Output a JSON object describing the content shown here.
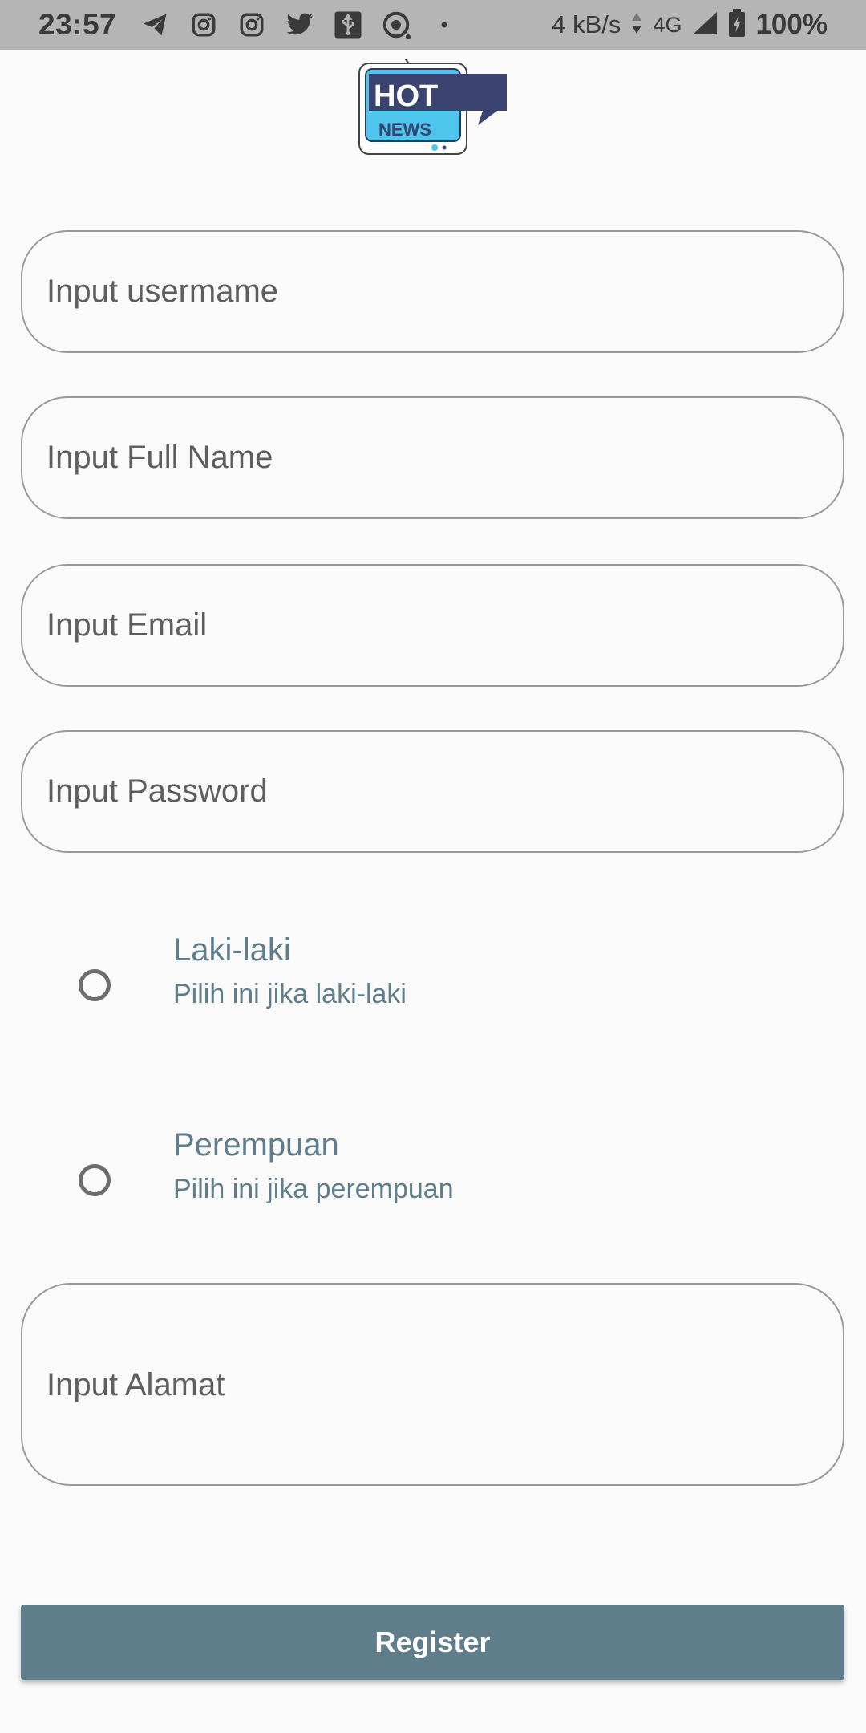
{
  "status_bar": {
    "time": "23:57",
    "net_speed": "4 kB/s",
    "network_type": "4G",
    "battery_percent": "100%",
    "left_icons": [
      "telegram-icon",
      "instagram-icon",
      "instagram-icon",
      "twitter-icon",
      "usb-icon",
      "vpn-icon"
    ],
    "bg_color": "#b5b5b5"
  },
  "logo": {
    "line1": "HOT",
    "line2": "NEWS"
  },
  "form": {
    "username_placeholder": "Input usermame",
    "fullname_placeholder": "Input Full Name",
    "email_placeholder": "Input Email",
    "password_placeholder": "Input Password",
    "address_placeholder": "Input Alamat",
    "gender_options": [
      {
        "title": "Laki-laki",
        "subtitle": "Pilih ini jika laki-laki",
        "selected": false
      },
      {
        "title": "Perempuan",
        "subtitle": "Pilih ini jika perempuan",
        "selected": false
      }
    ],
    "register_label": "Register"
  },
  "colors": {
    "accent": "#607d8b",
    "background": "#fafafa",
    "field_border": "#9a9a9a"
  }
}
